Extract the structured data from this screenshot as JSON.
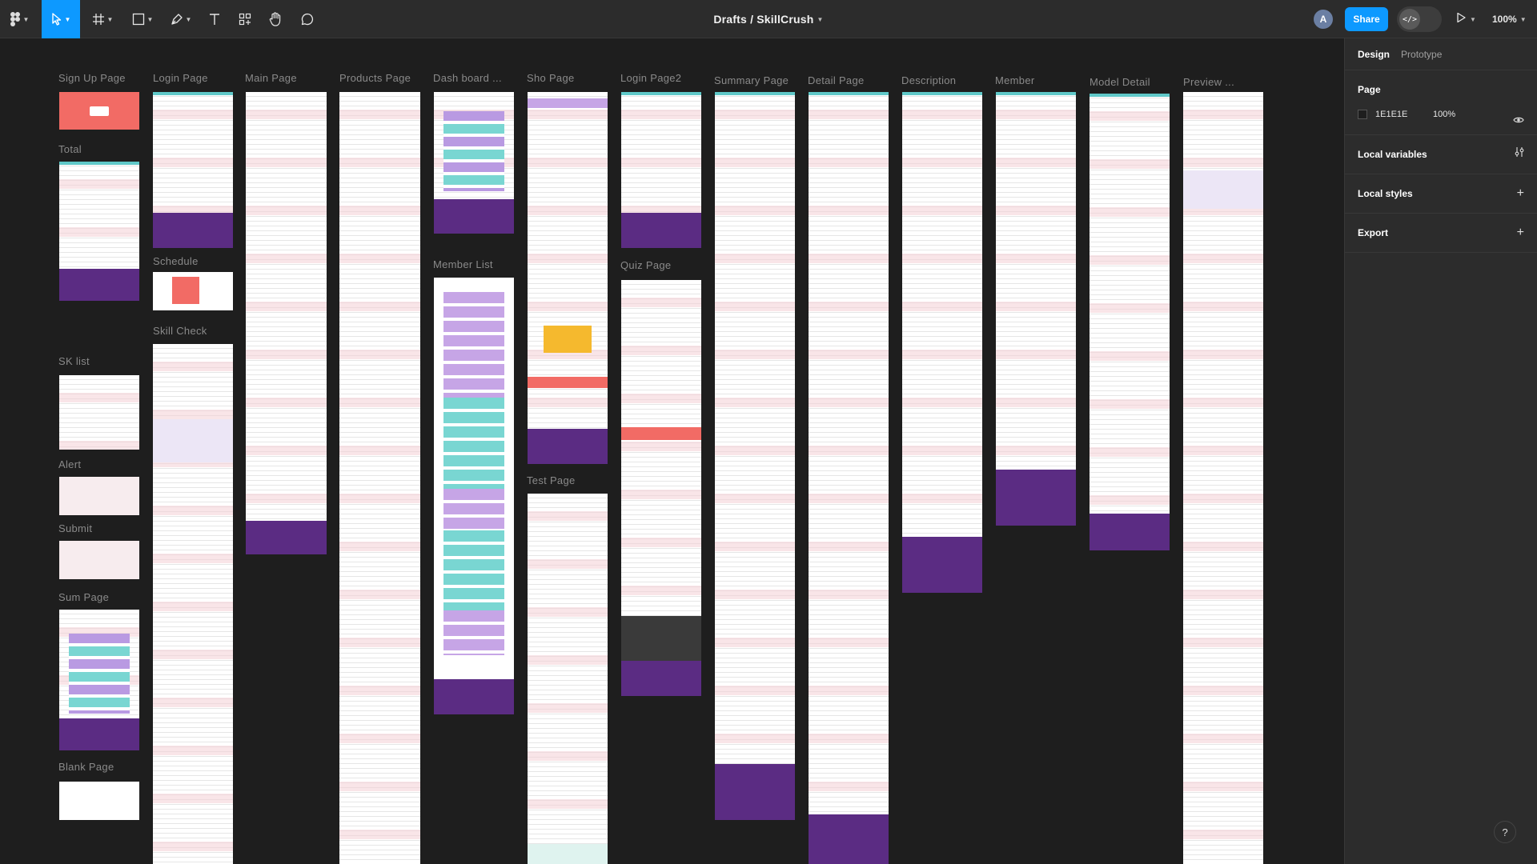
{
  "toolbar": {
    "document_title": "Drafts / SkillCrush",
    "avatar_initial": "A",
    "share_label": "Share",
    "dev_mode_icon": "</>",
    "zoom_label": "100%"
  },
  "panel": {
    "tabs": [
      "Design",
      "Prototype"
    ],
    "active_tab": "Design",
    "page_section_title": "Page",
    "page_bg_hex": "1E1E1E",
    "page_bg_opacity": "100%",
    "local_variables_label": "Local variables",
    "local_styles_label": "Local styles",
    "export_label": "Export",
    "help_label": "?"
  },
  "colors": {
    "canvas": "#1e1e1e",
    "ui_dark": "#2c2c2c",
    "accent": "#0d99ff",
    "brand_salmon": "#f26b65",
    "brand_purple": "#5b2c83",
    "brand_teal": "#5fc8c8"
  },
  "frames": {
    "sign_up": "Sign Up Page",
    "total": "Total",
    "sk_list": "SK list",
    "alert": "Alert",
    "submit": "Submit",
    "sum_page": "Sum Page",
    "blank_page": "Blank Page",
    "login": "Login Page",
    "schedule": "Schedule",
    "skill_check": "Skill Check",
    "main": "Main Page",
    "products": "Products Page",
    "dashboard": "Dash board ...",
    "member_list": "Member List",
    "shop": "Sho Page",
    "test": "Test Page",
    "login2": "Login Page2",
    "quiz": "Quiz Page",
    "summary": "Summary Page",
    "detail": "Detail Page",
    "description": "Description",
    "member": "Member",
    "model_detail": "Model Detail",
    "preview": "Preview ..."
  }
}
